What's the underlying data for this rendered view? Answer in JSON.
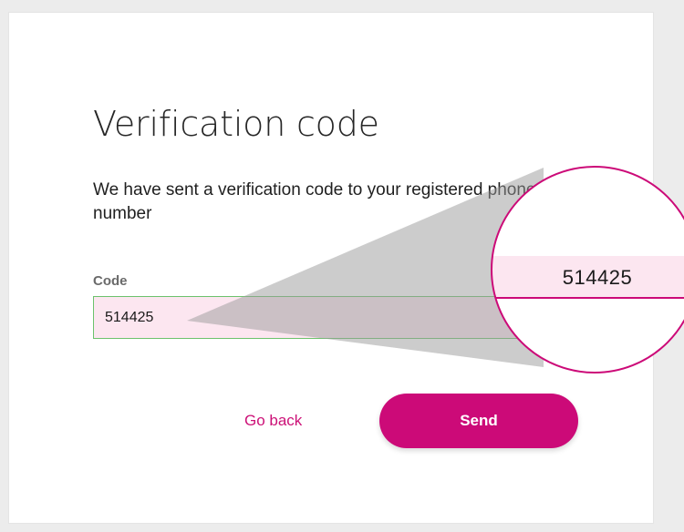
{
  "page": {
    "title": "Verification code",
    "description": "We have sent a verification code to your registered phone number"
  },
  "form": {
    "code_label": "Code",
    "code_value": "514425"
  },
  "actions": {
    "go_back_label": "Go back",
    "send_label": "Send"
  },
  "magnifier": {
    "zoomed_value": "514425"
  },
  "colors": {
    "accent": "#cc0a78",
    "input_border": "#6cc26c",
    "input_highlight": "#fce6f0"
  }
}
